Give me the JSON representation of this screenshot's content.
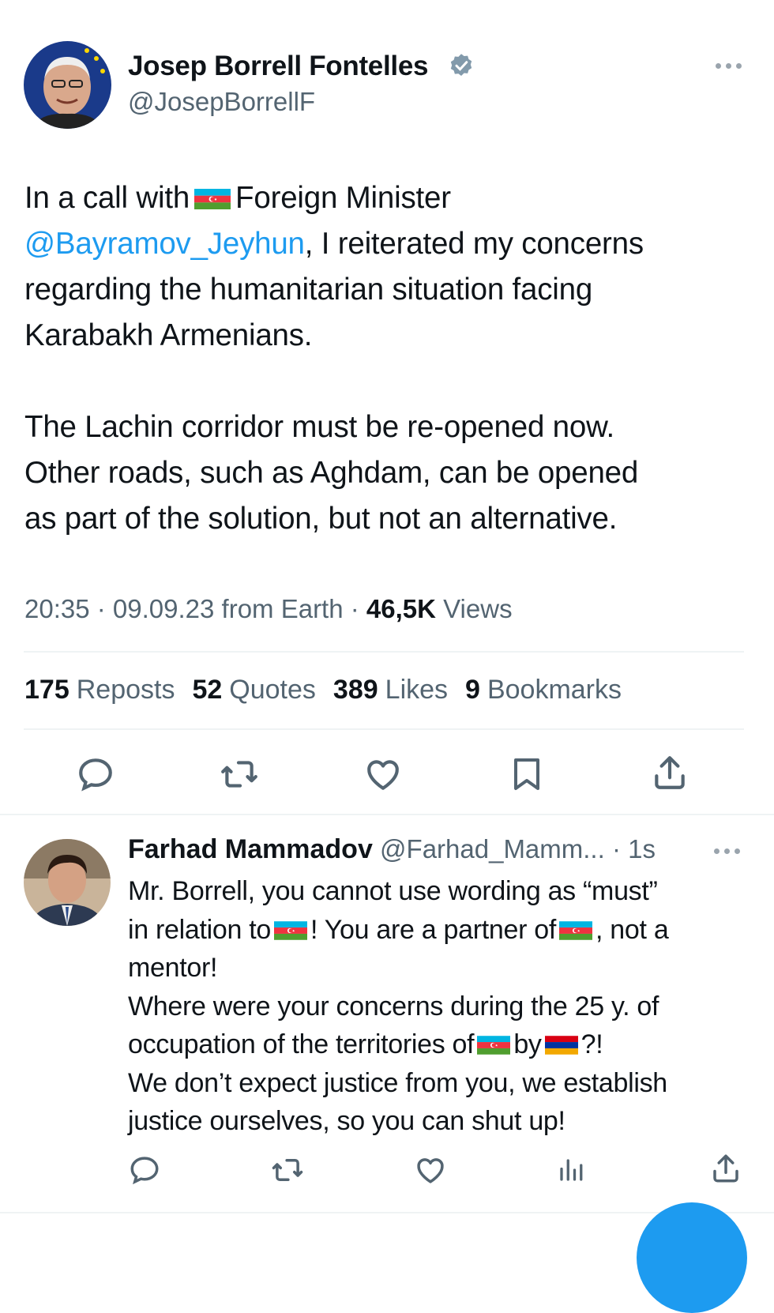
{
  "tweet": {
    "author_name": "Josep Borrell Fontelles",
    "author_handle": "@JosepBorrellF",
    "text_p1_a": "In a call with",
    "text_p1_b": "Foreign Minister",
    "mention": "@Bayramov_Jeyhun",
    "text_p1_c": ", I reiterated my concerns",
    "text_p1_d": "regarding the humanitarian situation facing",
    "text_p1_e": "Karabakh Armenians.",
    "text_p2_a": "The Lachin corridor must be re-opened now.",
    "text_p2_b": "Other roads, such as Aghdam, can be opened",
    "text_p2_c": "as part of the solution, but not an alternative.",
    "time": "20:35 · 09.09.23 from Earth · ",
    "views_count": "46,5K",
    "views_label": "Views",
    "reposts_count": "175",
    "reposts_label": "Reposts",
    "quotes_count": "52",
    "quotes_label": "Quotes",
    "likes_count": "389",
    "likes_label": "Likes",
    "bookmarks_count": "9",
    "bookmarks_label": "Bookmarks"
  },
  "reply": {
    "author_name": "Farhad Mammadov",
    "author_handle": "@Farhad_Mamm...",
    "time": "· 1s",
    "line1": "Mr. Borrell, you cannot use wording as “must”",
    "line2_a": "in relation to",
    "line2_b": "! You are a partner of",
    "line2_c": ", not a",
    "line3": "mentor!",
    "line4": "Where were your concerns during the 25 y. of",
    "line5_a": "occupation of the territories of",
    "line5_b": "by",
    "line5_c": "?!",
    "line6": "We don’t expect justice from you, we establish",
    "line7": "justice ourselves, so you can shut up!"
  },
  "colors": {
    "accent": "#1d9bf0",
    "text": "#0f1419",
    "muted": "#536471"
  },
  "icons": [
    "verified-badge-icon",
    "more-icon",
    "reply-icon",
    "repost-icon",
    "like-icon",
    "bookmark-icon",
    "share-icon",
    "views-icon",
    "azerbaijan-flag-icon",
    "armenia-flag-icon"
  ]
}
